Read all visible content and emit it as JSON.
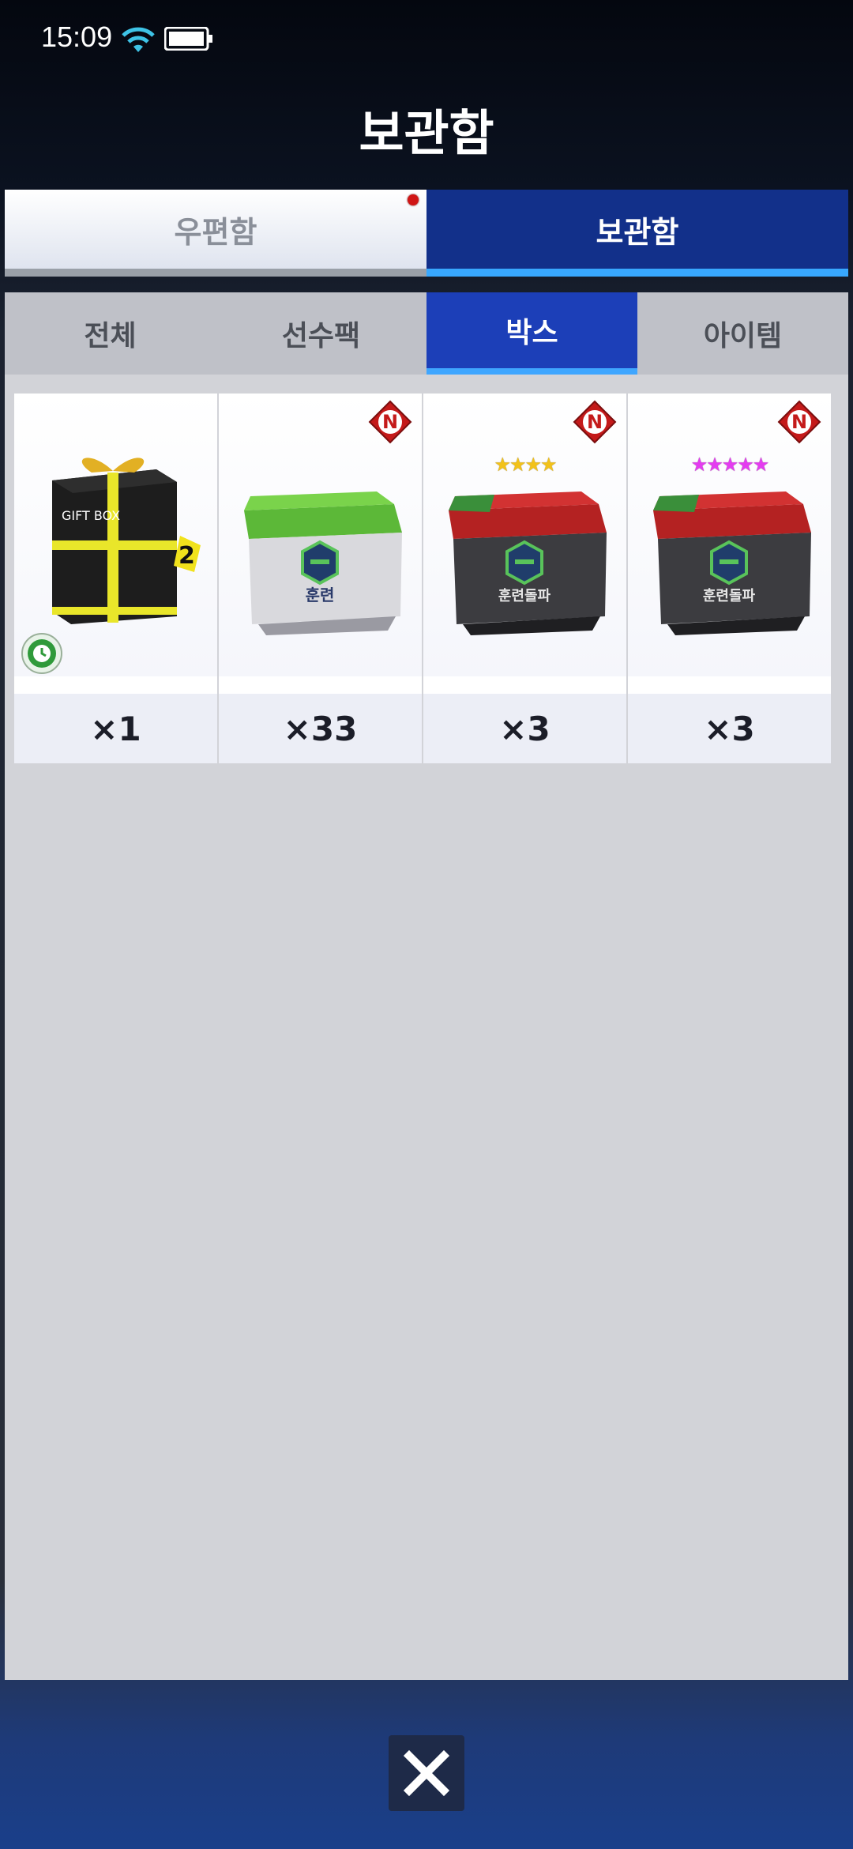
{
  "status_bar": {
    "time": "15:09"
  },
  "header": {
    "title": "보관함"
  },
  "top_tabs": [
    {
      "label": "우편함",
      "active": false,
      "has_notification": true
    },
    {
      "label": "보관함",
      "active": true
    }
  ],
  "category_tabs": [
    {
      "label": "전체",
      "active": false
    },
    {
      "label": "선수팩",
      "active": false
    },
    {
      "label": "박스",
      "active": true
    },
    {
      "label": "아이템",
      "active": false
    }
  ],
  "items": [
    {
      "name": "gift-box-special",
      "box_text": "GIFT BOX",
      "tag": "2",
      "count": "×1",
      "has_timer": true,
      "new_badge": false
    },
    {
      "name": "training-box",
      "box_label": "훈련",
      "count": "×33",
      "new_badge": true,
      "badge_text": "N"
    },
    {
      "name": "training-breakthrough-box-4star",
      "box_label": "훈련돌파",
      "stars": 4,
      "star_color": "#f2c21a",
      "count": "×3",
      "new_badge": true,
      "badge_text": "N"
    },
    {
      "name": "training-breakthrough-box-5star",
      "box_label": "훈련돌파",
      "stars": 5,
      "star_color": "#e43cf0",
      "count": "×3",
      "new_badge": true,
      "badge_text": "N"
    }
  ],
  "icons": {
    "close": "close-icon",
    "wifi": "wifi-icon",
    "battery": "battery-icon",
    "timer": "clock-icon"
  }
}
